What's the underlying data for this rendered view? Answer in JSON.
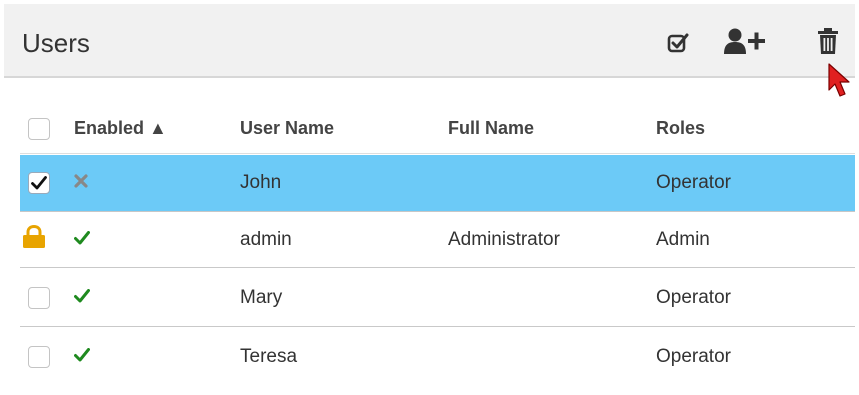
{
  "header": {
    "title": "Users"
  },
  "icons": {
    "select_all": "checkbox-check-icon",
    "add_user": "add-user-icon",
    "delete": "trash-icon",
    "cursor": "mouse-pointer-icon"
  },
  "table": {
    "columns": {
      "enabled": "Enabled ▲",
      "user_name": "User Name",
      "full_name": "Full Name",
      "roles": "Roles"
    },
    "rows": [
      {
        "selected": true,
        "enabled": false,
        "user_name": "John",
        "full_name": "",
        "roles": "Operator"
      },
      {
        "locked": true,
        "enabled": true,
        "user_name": "admin",
        "full_name": "Administrator",
        "roles": "Admin"
      },
      {
        "selected": false,
        "enabled": true,
        "user_name": "Mary",
        "full_name": "",
        "roles": "Operator"
      },
      {
        "selected": false,
        "enabled": true,
        "user_name": "Teresa",
        "full_name": "",
        "roles": "Operator"
      }
    ]
  },
  "colors": {
    "selected_row": "#6ccaf7",
    "enabled_check": "#1f8a1f",
    "disabled_x": "#888888",
    "lock": "#e8a400",
    "cursor": "#e02020"
  }
}
